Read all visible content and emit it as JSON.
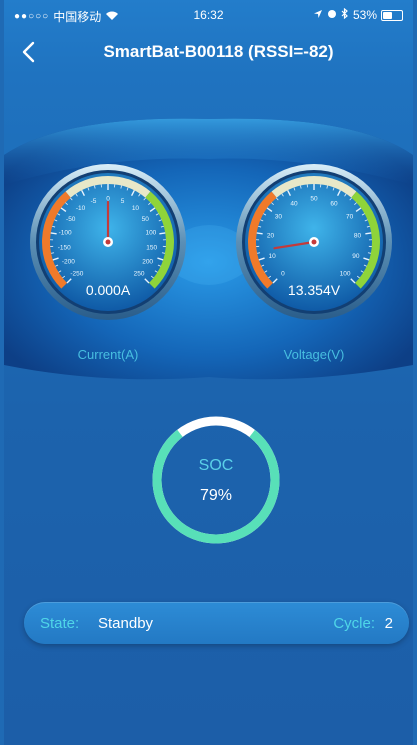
{
  "status_bar": {
    "carrier": "中国移动",
    "time": "16:32",
    "battery_text": "53%",
    "battery_level": 0.53
  },
  "nav": {
    "title": "SmartBat-B00118 (RSSI=-82)"
  },
  "current_gauge": {
    "value_text": "0.000A",
    "caption": "Current(A)",
    "ticks": [
      "-250",
      "-200",
      "-150",
      "-100",
      "-50",
      "-10",
      "-5",
      "0",
      "5",
      "10",
      "50",
      "100",
      "150",
      "200",
      "250"
    ],
    "needle_value": 0
  },
  "voltage_gauge": {
    "value_text": "13.354V",
    "caption": "Voltage(V)",
    "ticks": [
      "0",
      "10",
      "20",
      "30",
      "40",
      "50",
      "60",
      "70",
      "80",
      "90",
      "100"
    ],
    "needle_value": 13.354
  },
  "soc": {
    "label": "SOC",
    "value_text": "79%",
    "percent": 79
  },
  "state": {
    "state_label": "State:",
    "state_value": "Standby",
    "cycle_label": "Cycle:",
    "cycle_value": "2"
  },
  "colors": {
    "accent_cyan": "#4fd6e8",
    "ring_green": "#58e0b8",
    "gauge_orange": "#f07a2a",
    "gauge_green": "#8fd43a"
  }
}
